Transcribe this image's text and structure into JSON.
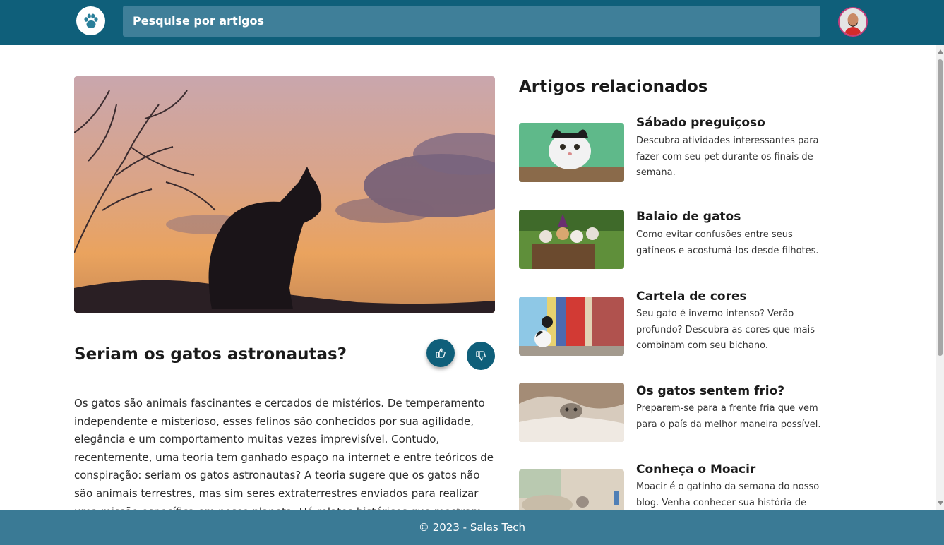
{
  "header": {
    "logo_icon": "paw-icon",
    "search": {
      "placeholder": "Pesquise por artigos"
    },
    "avatar": "user-avatar",
    "colors": {
      "primary": "#0f5f7a",
      "search_bg": "#3f7f99"
    }
  },
  "article": {
    "image": "cat-silhouette-sunset",
    "title": "Seriam os gatos astronautas?",
    "like_icon": "thumbs-up-icon",
    "dislike_icon": "thumbs-down-icon",
    "body": "Os gatos são animais fascinantes e cercados de mistérios. De temperamento independente e misterioso, esses felinos são conhecidos por sua agilidade, elegância e um comportamento muitas vezes imprevisível. Contudo, recentemente, uma teoria tem ganhado espaço na internet e entre teóricos de conspiração: seriam os gatos astronautas? A teoria sugere que os gatos não são animais terrestres, mas sim seres extraterrestres enviados para realizar uma missão específica em nosso planeta. Há relatos históricos que mostram"
  },
  "related": {
    "heading": "Artigos relacionados",
    "items": [
      {
        "title": "Sábado preguiçoso",
        "description": "Descubra atividades interessantes para fazer com seu pet durante os finais de semana.",
        "image": "cat-green-wall"
      },
      {
        "title": "Balaio de gatos",
        "description": "Como evitar confusões entre seus gatíneos e acostumá-los desde filhotes.",
        "image": "kittens-in-basket"
      },
      {
        "title": "Cartela de cores",
        "description": "Seu gato é inverno intenso? Verão profundo? Descubra as cores que mais combinam com seu bichano.",
        "image": "cat-colorful-wall"
      },
      {
        "title": "Os gatos sentem frio?",
        "description": "Preparem-se para a frente fria que vem para o país da melhor maneira possível.",
        "image": "cat-under-blanket"
      },
      {
        "title": "Conheça o Moacir",
        "description": "Moacir é o gatinho da semana do nosso blog. Venha conhecer sua história de",
        "image": "kitten-on-bed"
      }
    ]
  },
  "footer": {
    "text": "© 2023 - Salas Tech"
  }
}
